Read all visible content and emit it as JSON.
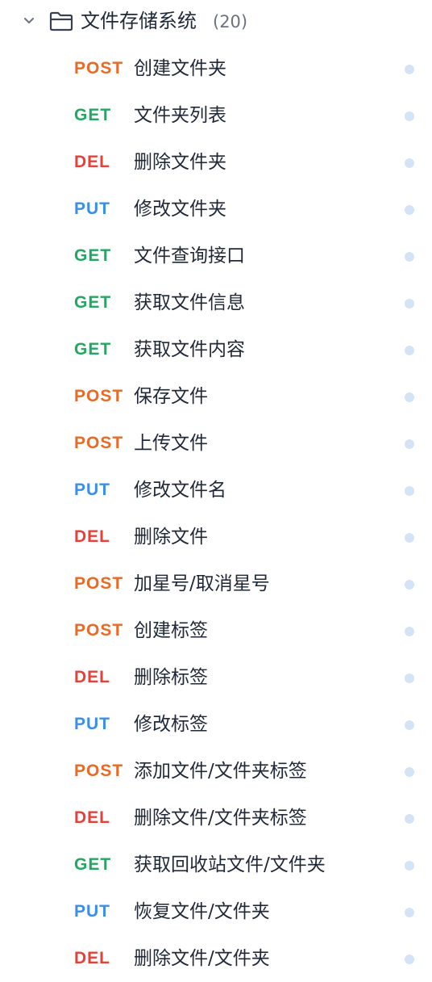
{
  "folder": {
    "name": "文件存储系统",
    "count": "(20)"
  },
  "colors": {
    "POST": "#ea6a25",
    "GET": "#22a862",
    "DEL": "#e5413b",
    "PUT": "#3b8eea"
  },
  "endpoints": [
    {
      "method": "POST",
      "name": "创建文件夹"
    },
    {
      "method": "GET",
      "name": "文件夹列表"
    },
    {
      "method": "DEL",
      "name": "删除文件夹"
    },
    {
      "method": "PUT",
      "name": "修改文件夹"
    },
    {
      "method": "GET",
      "name": "文件查询接口"
    },
    {
      "method": "GET",
      "name": "获取文件信息"
    },
    {
      "method": "GET",
      "name": "获取文件内容"
    },
    {
      "method": "POST",
      "name": "保存文件"
    },
    {
      "method": "POST",
      "name": "上传文件"
    },
    {
      "method": "PUT",
      "name": "修改文件名"
    },
    {
      "method": "DEL",
      "name": "删除文件"
    },
    {
      "method": "POST",
      "name": "加星号/取消星号"
    },
    {
      "method": "POST",
      "name": "创建标签"
    },
    {
      "method": "DEL",
      "name": "删除标签"
    },
    {
      "method": "PUT",
      "name": "修改标签"
    },
    {
      "method": "POST",
      "name": "添加文件/文件夹标签"
    },
    {
      "method": "DEL",
      "name": "删除文件/文件夹标签"
    },
    {
      "method": "GET",
      "name": "获取回收站文件/文件夹"
    },
    {
      "method": "PUT",
      "name": "恢复文件/文件夹"
    },
    {
      "method": "DEL",
      "name": "删除文件/文件夹"
    }
  ]
}
